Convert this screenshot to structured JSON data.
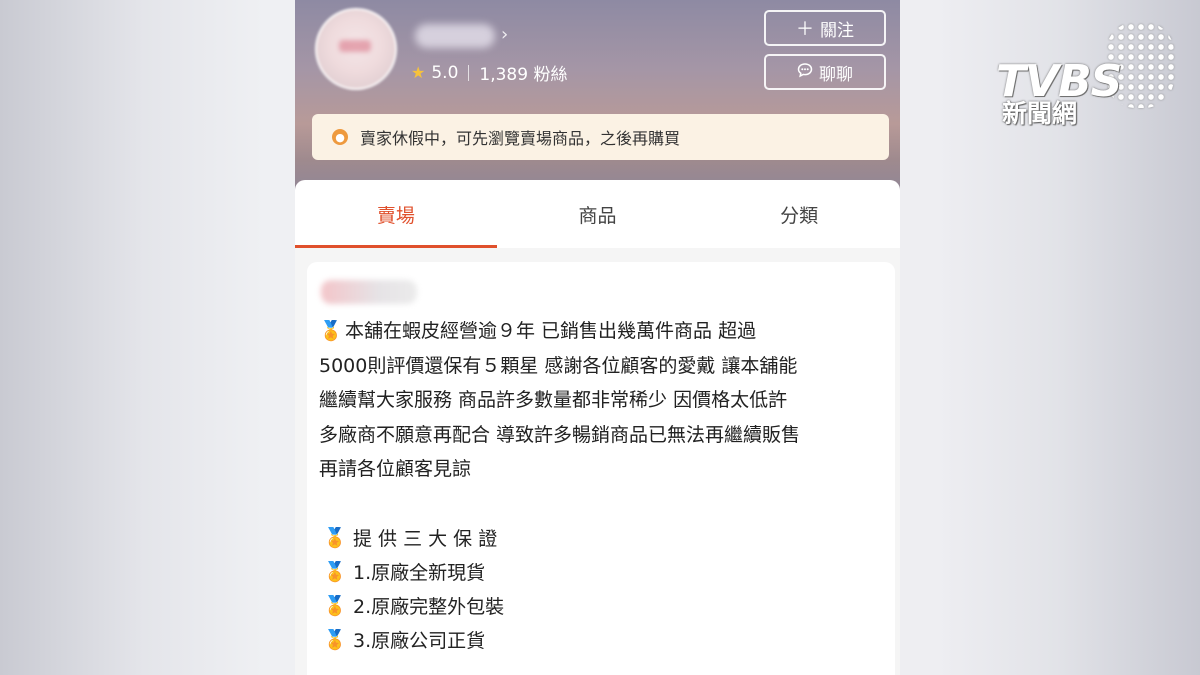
{
  "store": {
    "rating": "5.0",
    "followers": "1,389 粉絲",
    "follow_label": "關注",
    "chat_label": "聊聊",
    "notice": "賣家休假中，可先瀏覽賣場商品，之後再購買"
  },
  "tabs": [
    {
      "label": "賣場",
      "active": true
    },
    {
      "label": "商品",
      "active": false
    },
    {
      "label": "分類",
      "active": false
    }
  ],
  "description": {
    "lines": [
      "本舖在蝦皮經營逾９年 已銷售出幾萬件商品 超過",
      "5000則評價還保有５顆星 感謝各位顧客的愛戴 讓本舖能",
      "繼續幫大家服務 商品許多數量都非常稀少 因價格太低許",
      "多廠商不願意再配合 導致許多暢銷商品已無法再繼續販售",
      "再請各位顧客見諒"
    ],
    "guarantees": [
      "提 供 三 大 保 證",
      "1.原廠全新現貨",
      "2.原廠完整外包裝",
      "3.原廠公司正貨"
    ]
  },
  "watermark": {
    "brand": "TVBS",
    "subtitle": "新聞網"
  },
  "colors": {
    "accent": "#e0502c",
    "notice_bg": "#fbf2e4",
    "star": "#f7c23b"
  }
}
